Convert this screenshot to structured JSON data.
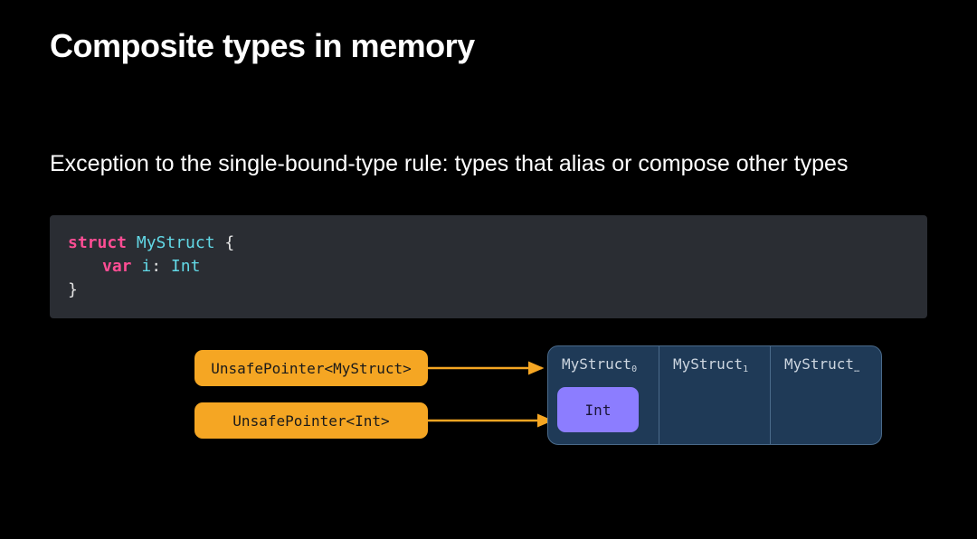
{
  "title": "Composite types in memory",
  "subtitle": "Exception to the single-bound-type rule: types that alias or compose other types",
  "code": {
    "kw_struct": "struct",
    "typename": "MyStruct",
    "brace_open": "{",
    "kw_var": "var",
    "field_name": "i",
    "colon": ":",
    "field_type": "Int",
    "brace_close": "}"
  },
  "diagram": {
    "pointer_struct": "UnsafePointer<MyStruct>",
    "pointer_int": "UnsafePointer<Int>",
    "cells": [
      {
        "label": "MyStruct",
        "sub": "0"
      },
      {
        "label": "MyStruct",
        "sub": "1"
      },
      {
        "label": "MyStruct",
        "sub": "…"
      }
    ],
    "int_label": "Int",
    "arrow_color": "#f5a623"
  }
}
